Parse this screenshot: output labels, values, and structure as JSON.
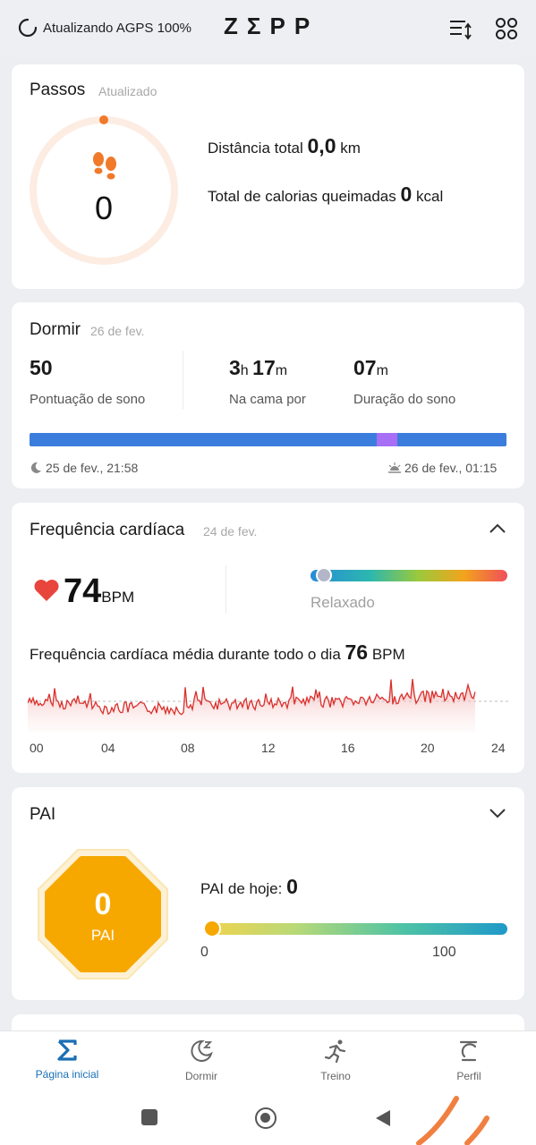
{
  "header": {
    "sync_status": "Atualizando AGPS 100%",
    "logo": "ZΣPP"
  },
  "steps": {
    "title": "Passos",
    "status": "Atualizado",
    "count": "0",
    "distance_label": "Distância total",
    "distance_value": "0,0",
    "distance_unit": "km",
    "calories_label": "Total de calorias queimadas",
    "calories_value": "0",
    "calories_unit": "kcal",
    "progress": 0
  },
  "sleep": {
    "title": "Dormir",
    "date": "26 de fev.",
    "score_value": "50",
    "score_label": "Pontuação de sono",
    "bed_hours": "3",
    "bed_h_unit": "h",
    "bed_minutes": "17",
    "bed_m_unit": "m",
    "bed_label": "Na cama por",
    "duration_value": "07",
    "duration_unit": "m",
    "duration_label": "Duração do sono",
    "start": "25 de fev., 21:58",
    "end": "26 de fev., 01:15"
  },
  "heart": {
    "title": "Frequência cardíaca",
    "date": "24 de fev.",
    "bpm": "74",
    "bpm_unit": "BPM",
    "zone": "Relaxado",
    "avg_label": "Frequência cardíaca média durante todo o dia",
    "avg_value": "76",
    "avg_unit": "BPM",
    "x_ticks": [
      "00",
      "04",
      "08",
      "12",
      "16",
      "20",
      "24"
    ]
  },
  "pai": {
    "title": "PAI",
    "value": "0",
    "badge_label": "PAI",
    "today_label": "PAI de hoje:",
    "today_value": "0",
    "scale_min": "0",
    "scale_max": "100"
  },
  "nav": {
    "items": [
      {
        "label": "Página inicial",
        "active": true
      },
      {
        "label": "Dormir"
      },
      {
        "label": "Treino"
      },
      {
        "label": "Perfil"
      }
    ]
  },
  "colors": {
    "accent": "#1a6fb5",
    "steps": "#f07a2a",
    "heart": "#e8453c",
    "pai": "#f7a800",
    "sleep_bar": "#3b7ddd",
    "sleep_awake": "#a76ff5"
  }
}
